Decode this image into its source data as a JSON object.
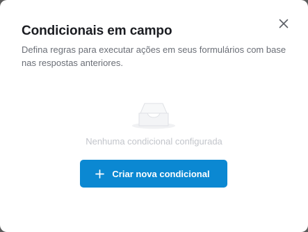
{
  "modal": {
    "title": "Condicionais em campo",
    "subtitle": "Defina regras para executar ações em seus formulários com base nas respostas anteriores.",
    "close_icon": "close-icon"
  },
  "empty_state": {
    "icon": "inbox-tray-icon",
    "message": "Nenhuma condicional configurada"
  },
  "actions": {
    "create_label": "Criar nova condicional",
    "create_icon": "plus-icon"
  },
  "colors": {
    "primary": "#0b88d2",
    "title": "#1b1d22",
    "muted_text": "#c2c5cb"
  }
}
